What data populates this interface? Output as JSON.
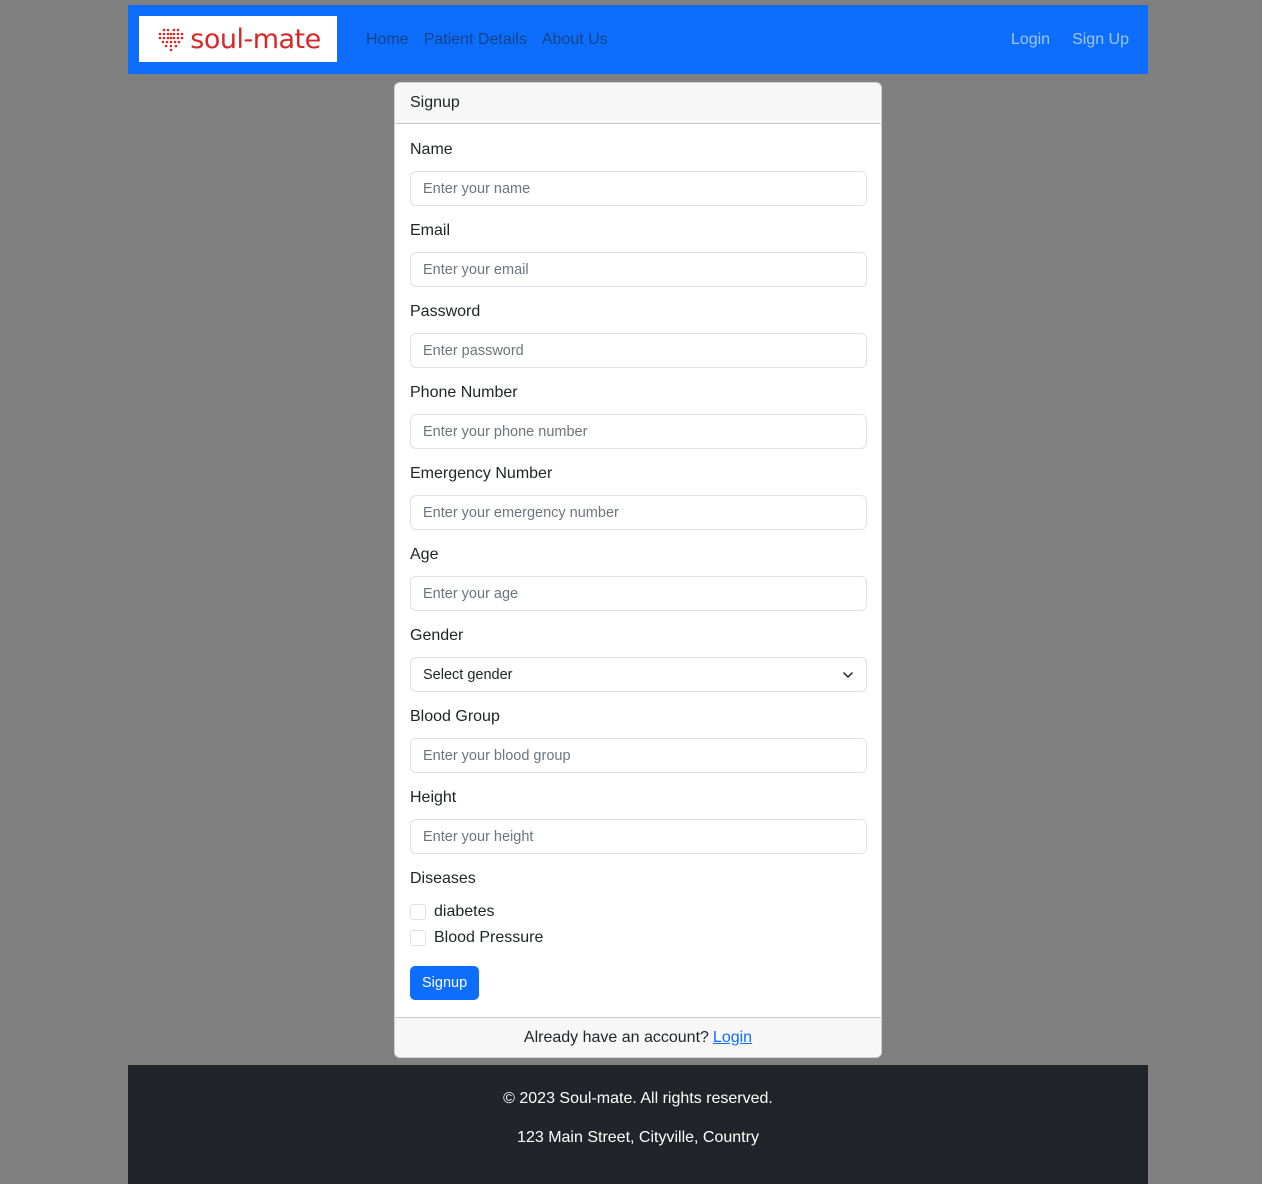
{
  "brand": {
    "name": "soul-mate",
    "color": "#d62828"
  },
  "nav": {
    "left": [
      "Home",
      "Patient Details",
      "About Us"
    ],
    "right": [
      "Login",
      "Sign Up"
    ],
    "bg": "#0d6efd"
  },
  "card": {
    "header": "Signup",
    "fields": [
      {
        "label": "Name",
        "placeholder": "Enter your name"
      },
      {
        "label": "Email",
        "placeholder": "Enter your email"
      },
      {
        "label": "Password",
        "placeholder": "Enter password"
      },
      {
        "label": "Phone Number",
        "placeholder": "Enter your phone number"
      },
      {
        "label": "Emergency Number",
        "placeholder": "Enter your emergency number"
      },
      {
        "label": "Age",
        "placeholder": "Enter your age"
      }
    ],
    "gender": {
      "label": "Gender",
      "selected": "Select gender"
    },
    "fields2": [
      {
        "label": "Blood Group",
        "placeholder": "Enter your blood group"
      },
      {
        "label": "Height",
        "placeholder": "Enter your height"
      }
    ],
    "diseases": {
      "label": "Diseases",
      "options": [
        "diabetes",
        "Blood Pressure"
      ]
    },
    "submit": "Signup",
    "footer_text": "Already have an account?",
    "footer_link": "Login"
  },
  "footer": {
    "copyright": "© 2023 Soul-mate. All rights reserved.",
    "address": "123 Main Street, Cityville, Country"
  }
}
